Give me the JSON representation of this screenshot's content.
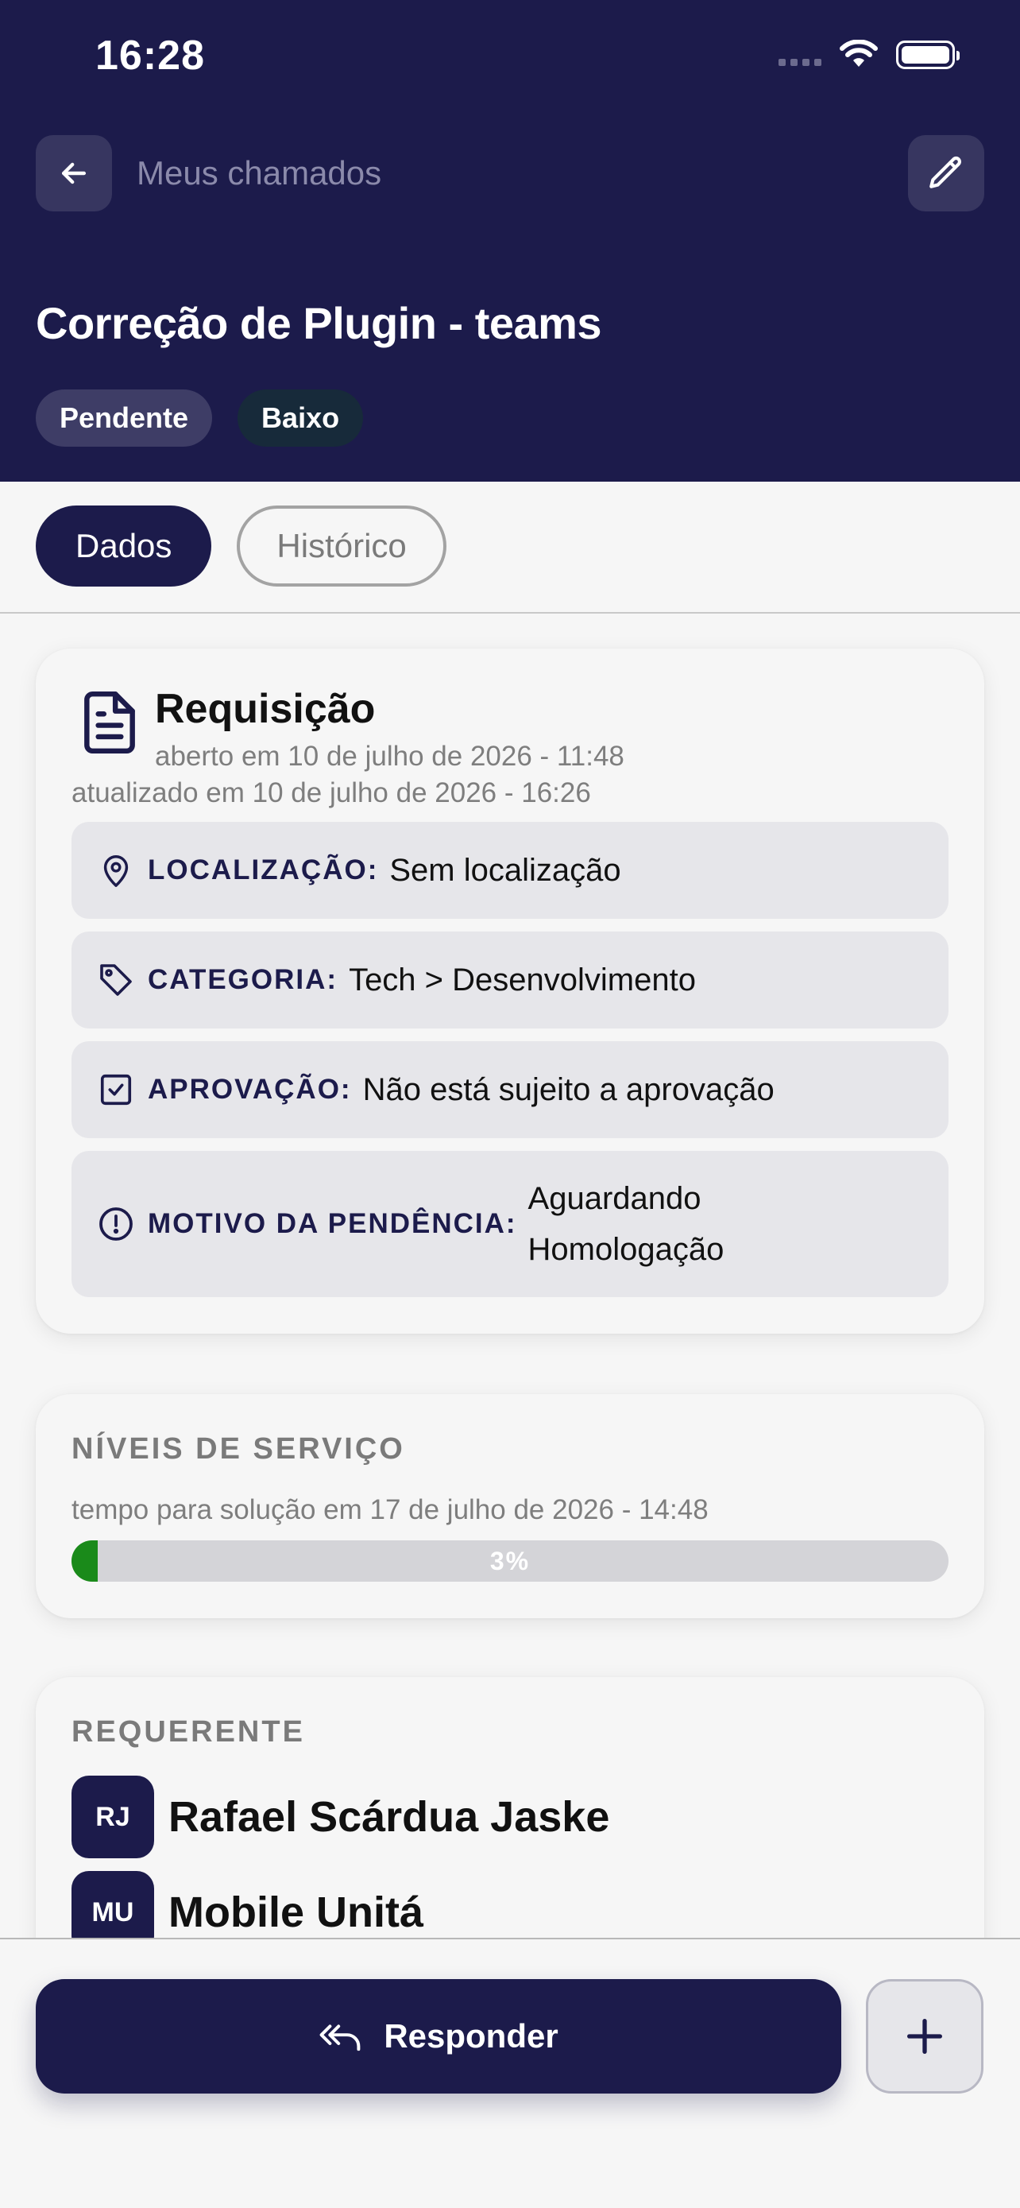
{
  "status_bar": {
    "time": "16:28",
    "icons": [
      "signal-dots-icon",
      "wifi-icon",
      "battery-icon"
    ]
  },
  "header": {
    "back_icon": "arrow-left-icon",
    "nav_title": "Meus chamados",
    "edit_icon": "pencil-icon",
    "title": "Correção de Plugin - teams",
    "chips": {
      "status": "Pendente",
      "priority": "Baixo"
    }
  },
  "tabs": [
    {
      "label": "Dados",
      "active": true
    },
    {
      "label": "Histórico",
      "active": false
    }
  ],
  "request_card": {
    "icon": "document-icon",
    "title": "Requisição",
    "opened": "aberto em 10 de julho de 2026 - 11:48",
    "updated": "atualizado em 10 de julho de 2026 - 16:26",
    "fields": [
      {
        "icon": "location-pin-icon",
        "label": "LOCALIZAÇÃO:",
        "value": "Sem localização"
      },
      {
        "icon": "tag-icon",
        "label": "CATEGORIA:",
        "value": "Tech > Desenvolvimento"
      },
      {
        "icon": "checkbox-icon",
        "label": "APROVAÇÃO:",
        "value": "Não está sujeito a aprovação"
      },
      {
        "icon": "alert-circle-icon",
        "label": "MOTIVO DA PENDÊNCIA:",
        "value": "Aguardando Homologação"
      }
    ]
  },
  "sla_card": {
    "heading": "NÍVEIS DE SERVIÇO",
    "text": "tempo para solução em 17 de julho de 2026 - 14:48",
    "progress_percent": 3,
    "progress_label": "3%",
    "progress_color": "#1a8a1a"
  },
  "requester_card": {
    "heading": "REQUERENTE",
    "people": [
      {
        "initials": "RJ",
        "name": "Rafael Scárdua Jaske"
      },
      {
        "initials": "MU",
        "name": "Mobile Unitá"
      }
    ]
  },
  "bottom": {
    "reply_icon": "reply-all-icon",
    "reply_label": "Responder",
    "plus_icon": "plus-icon"
  },
  "colors": {
    "primary": "#1c1b4b",
    "background": "#f6f6f6",
    "row_background": "#e6e6ea"
  }
}
